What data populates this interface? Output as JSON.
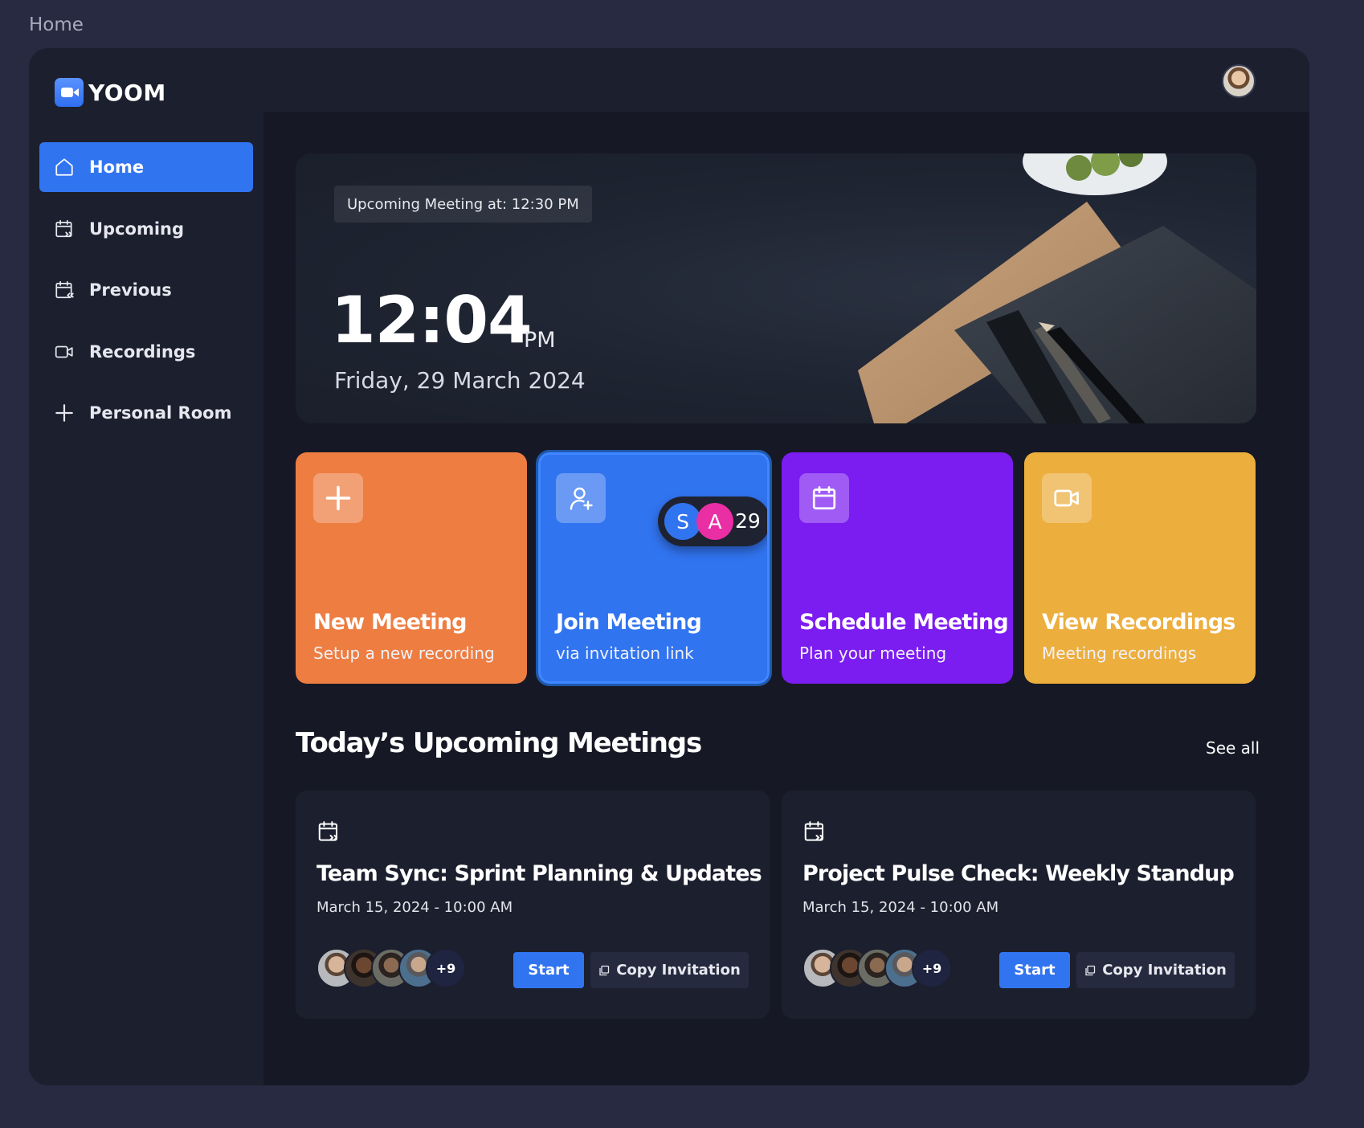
{
  "page_label": "Home",
  "app": {
    "name": "YOOM"
  },
  "sidebar": {
    "items": [
      {
        "label": "Home",
        "icon": "home-icon",
        "active": true
      },
      {
        "label": "Upcoming",
        "icon": "calendar-upcoming-icon",
        "active": false
      },
      {
        "label": "Previous",
        "icon": "calendar-previous-icon",
        "active": false
      },
      {
        "label": "Recordings",
        "icon": "video-icon",
        "active": false
      },
      {
        "label": "Personal Room",
        "icon": "plus-icon",
        "active": false
      }
    ]
  },
  "hero": {
    "badge": "Upcoming Meeting at:  12:30 PM",
    "time": "12:04",
    "ampm": "PM",
    "date": "Friday, 29 March 2024"
  },
  "cards": [
    {
      "title": "New Meeting",
      "subtitle": "Setup a new recording",
      "icon": "plus-icon",
      "color": "#ee7d42"
    },
    {
      "title": "Join Meeting",
      "subtitle": "via invitation link",
      "icon": "user-plus-icon",
      "color": "#3174f0"
    },
    {
      "title": "Schedule Meeting",
      "subtitle": "Plan your meeting",
      "icon": "calendar-icon",
      "color": "#7b1cf0"
    },
    {
      "title": "View Recordings",
      "subtitle": "Meeting recordings",
      "icon": "video-icon",
      "color": "#ecae3d"
    }
  ],
  "join_pill": {
    "initial_1": "S",
    "initial_2": "A",
    "count": "29"
  },
  "upcoming": {
    "title": "Today’s Upcoming Meetings",
    "see_all": "See all",
    "meetings": [
      {
        "title": "Team Sync: Sprint Planning & Updates",
        "date": "March 15, 2024 - 10:00 AM",
        "more": "+9",
        "start": "Start",
        "copy": "Copy Invitation"
      },
      {
        "title": "Project Pulse Check: Weekly Standup",
        "date": "March 15, 2024 - 10:00 AM",
        "more": "+9",
        "start": "Start",
        "copy": "Copy Invitation"
      }
    ]
  },
  "colors": {
    "accent": "#3174f0",
    "background": "#1c1f2e",
    "main": "#161925"
  }
}
